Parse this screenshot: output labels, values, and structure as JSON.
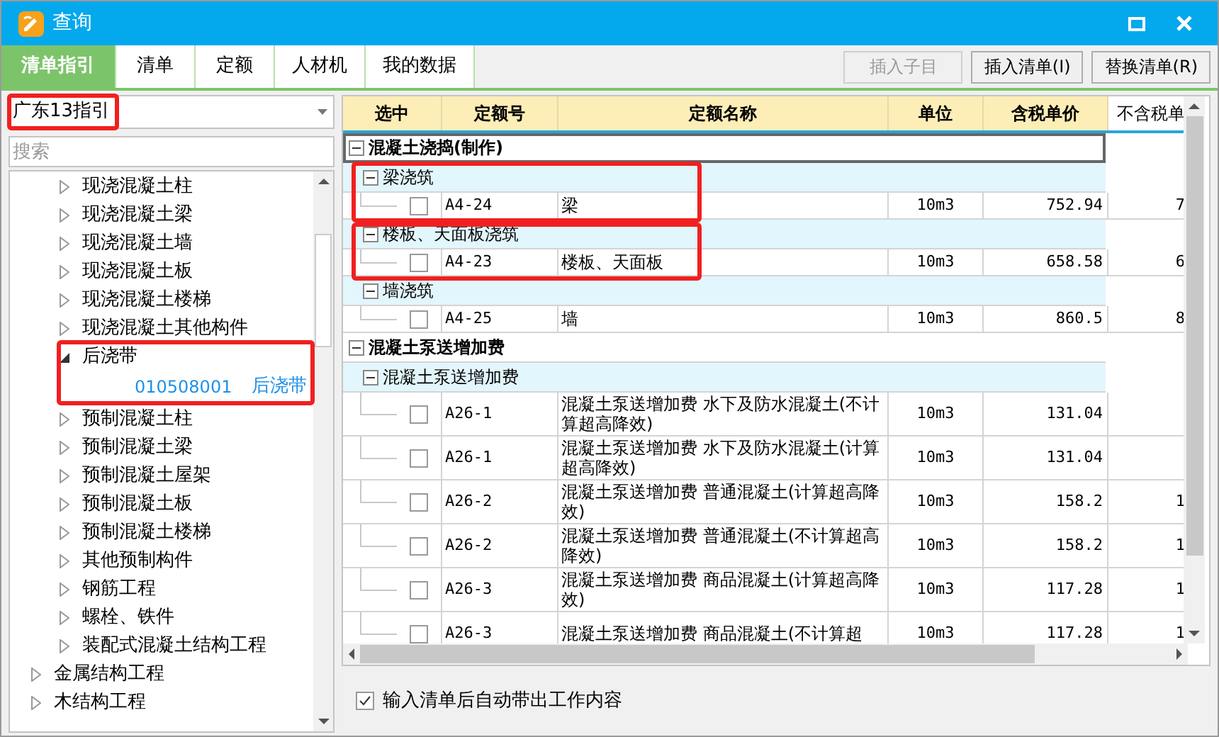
{
  "window": {
    "title": "查询"
  },
  "tabs": [
    {
      "label": "清单指引",
      "selected": true
    },
    {
      "label": "清单",
      "selected": false
    },
    {
      "label": "定额",
      "selected": false
    },
    {
      "label": "人材机",
      "selected": false
    },
    {
      "label": "我的数据",
      "selected": false
    }
  ],
  "toolbar": [
    {
      "label": "插入子目",
      "disabled": true
    },
    {
      "label": "插入清单(I)",
      "disabled": false
    },
    {
      "label": "替换清单(R)",
      "disabled": false
    }
  ],
  "library_select": {
    "value": "广东13指引"
  },
  "search": {
    "placeholder": "搜索"
  },
  "tree": [
    {
      "children": [
        {
          "label": "现浇混凝土柱",
          "expanded": false
        },
        {
          "label": "现浇混凝土梁",
          "expanded": false
        },
        {
          "label": "现浇混凝土墙",
          "expanded": false
        },
        {
          "label": "现浇混凝土板",
          "expanded": false
        },
        {
          "label": "现浇混凝土楼梯",
          "expanded": false
        },
        {
          "label": "现浇混凝土其他构件",
          "expanded": false
        },
        {
          "label": "后浇带",
          "expanded": true,
          "children": [
            {
              "code": "010508001",
              "label": "后浇带"
            }
          ]
        },
        {
          "label": "预制混凝土柱",
          "expanded": false
        },
        {
          "label": "预制混凝土梁",
          "expanded": false
        },
        {
          "label": "预制混凝土屋架",
          "expanded": false
        },
        {
          "label": "预制混凝土板",
          "expanded": false
        },
        {
          "label": "预制混凝土楼梯",
          "expanded": false
        },
        {
          "label": "其他预制构件",
          "expanded": false
        },
        {
          "label": "钢筋工程",
          "expanded": false
        },
        {
          "label": "螺栓、铁件",
          "expanded": false
        },
        {
          "label": "装配式混凝土结构工程",
          "expanded": false
        }
      ]
    },
    {
      "label": "金属结构工程",
      "expanded": false
    },
    {
      "label": "木结构工程",
      "expanded": false
    }
  ],
  "table": {
    "columns": [
      "选中",
      "定额号",
      "定额名称",
      "单位",
      "含税单价",
      "不含税单"
    ],
    "rows": [
      {
        "kind": "group",
        "label": "混凝土浇捣(制作)",
        "expanded": true,
        "selected": true
      },
      {
        "kind": "subgroup",
        "label": "梁浇筑",
        "expanded": true,
        "selected": false
      },
      {
        "kind": "item",
        "checked": false,
        "code": "A4-24",
        "name": "梁",
        "unit": "10m3",
        "price": "752.94",
        "column_6": "7",
        "selected": false
      },
      {
        "kind": "subgroup",
        "label": "楼板、天面板浇筑",
        "expanded": true,
        "selected": false
      },
      {
        "kind": "item",
        "checked": false,
        "code": "A4-23",
        "name": "楼板、天面板",
        "unit": "10m3",
        "price": "658.58",
        "column_6": "6",
        "selected": false
      },
      {
        "kind": "subgroup",
        "label": "墙浇筑",
        "expanded": true,
        "selected": false
      },
      {
        "kind": "item",
        "checked": false,
        "code": "A4-25",
        "name": "墙",
        "unit": "10m3",
        "price": "860.5",
        "column_6": "8",
        "selected": false
      },
      {
        "kind": "group",
        "label": "混凝土泵送增加费",
        "expanded": true,
        "selected": false
      },
      {
        "kind": "subgroup",
        "label": "混凝土泵送增加费",
        "expanded": true,
        "selected": false
      },
      {
        "kind": "item",
        "checked": false,
        "code": "A26-1",
        "name": "混凝土泵送增加费 水下及防水混凝土(不计算超高降效)",
        "unit": "10m3",
        "price": "131.04",
        "selected": false
      },
      {
        "kind": "item",
        "checked": false,
        "code": "A26-1",
        "name": "混凝土泵送增加费 水下及防水混凝土(计算超高降效)",
        "unit": "10m3",
        "price": "131.04",
        "selected": false
      },
      {
        "kind": "item",
        "checked": false,
        "code": "A26-2",
        "name": "混凝土泵送增加费 普通混凝土(计算超高降效)",
        "unit": "10m3",
        "price": "158.2",
        "column_6": "1",
        "selected": false
      },
      {
        "kind": "item",
        "checked": false,
        "code": "A26-2",
        "name": "混凝土泵送增加费 普通混凝土(不计算超高降效)",
        "unit": "10m3",
        "price": "158.2",
        "column_6": "1",
        "selected": false
      },
      {
        "kind": "item",
        "checked": false,
        "code": "A26-3",
        "name": "混凝土泵送增加费 商品混凝土(计算超高降效)",
        "unit": "10m3",
        "price": "117.28",
        "column_6": "1",
        "selected": false
      },
      {
        "kind": "item",
        "checked": false,
        "code": "A26-3",
        "name": "混凝土泵送增加费 商品混凝土(不计算超",
        "unit": "10m3",
        "price": "117.28",
        "column_6": "1",
        "selected": false
      }
    ]
  },
  "footer": {
    "option": {
      "label": "输入清单后自动带出工作内容",
      "checked": true
    }
  }
}
